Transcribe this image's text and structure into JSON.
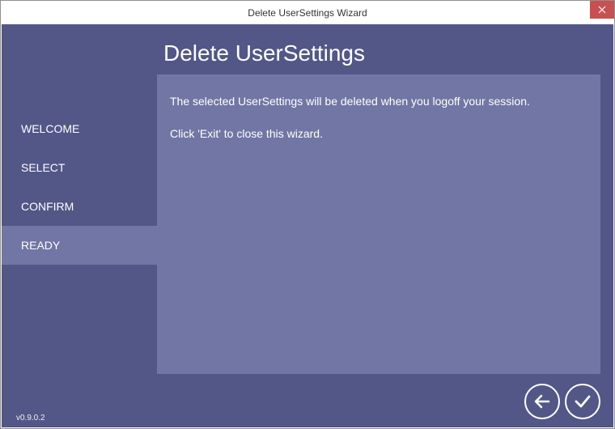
{
  "titlebar": {
    "title": "Delete UserSettings Wizard"
  },
  "header": {
    "title": "Delete UserSettings"
  },
  "sidebar": {
    "items": [
      {
        "label": "WELCOME",
        "active": false
      },
      {
        "label": "SELECT",
        "active": false
      },
      {
        "label": "CONFIRM",
        "active": false
      },
      {
        "label": "READY",
        "active": true
      }
    ]
  },
  "content": {
    "line1": "The selected UserSettings will be deleted when you logoff your session.",
    "line2": "Click 'Exit' to close this wizard."
  },
  "footer": {
    "version": "v0.9.0.2"
  }
}
